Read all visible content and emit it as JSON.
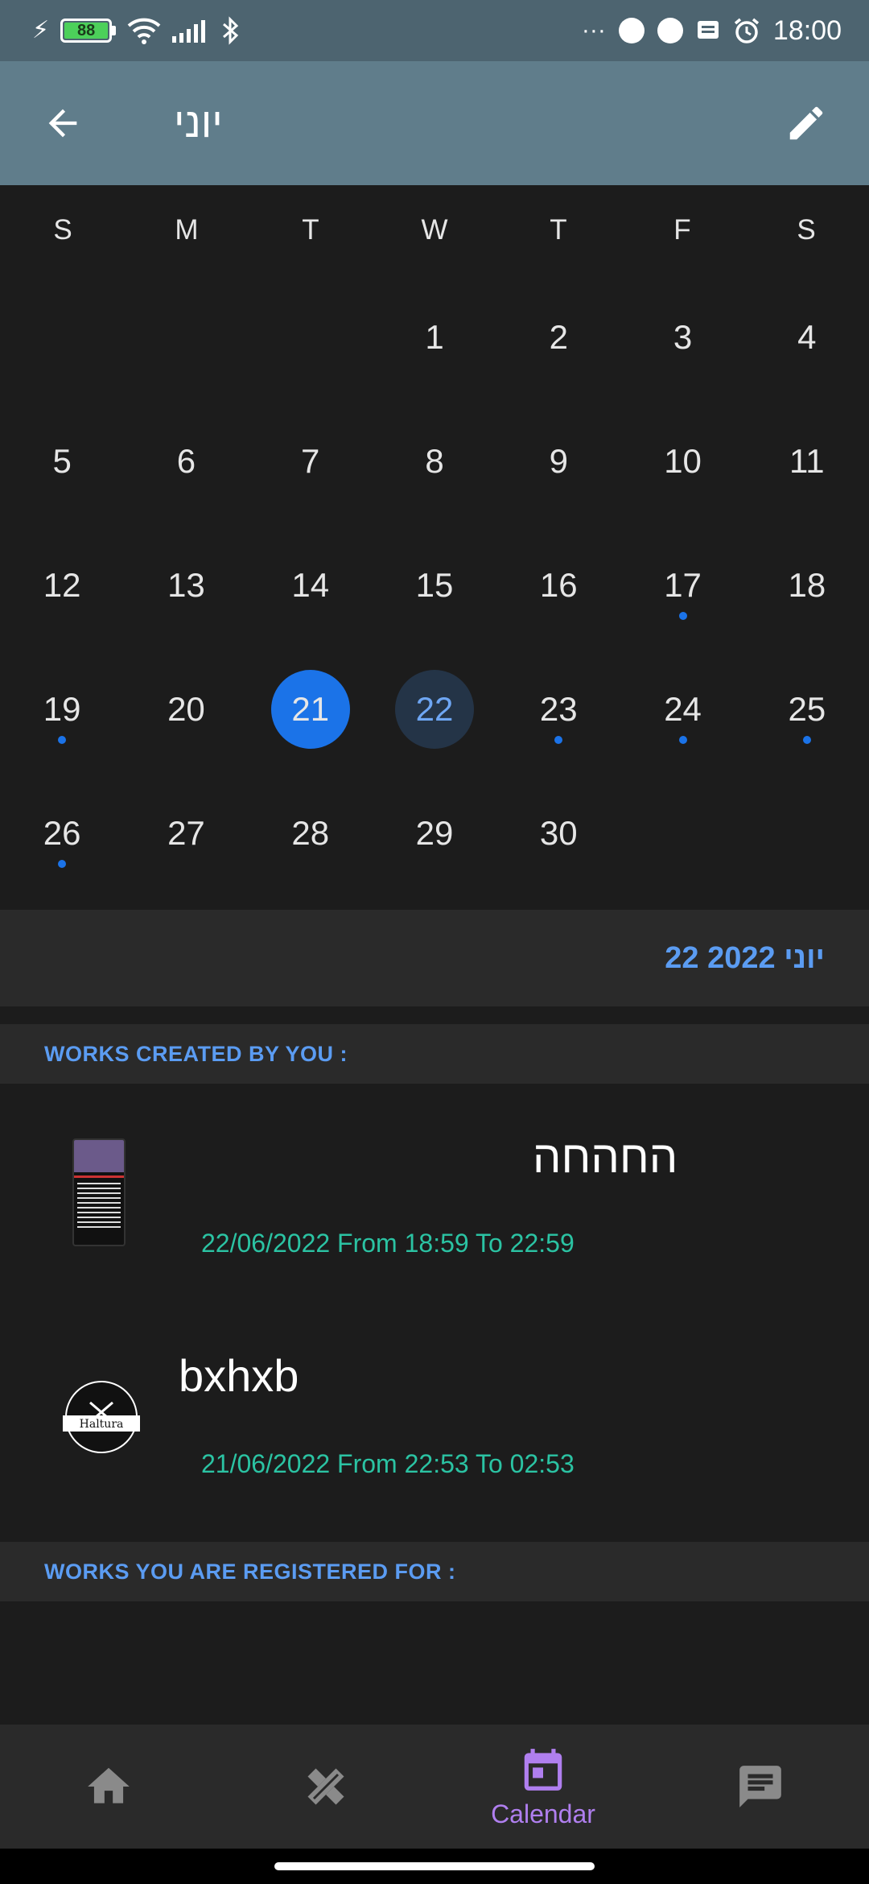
{
  "status_bar": {
    "battery": "88",
    "time": "18:00",
    "more": "···"
  },
  "app_bar": {
    "title": "יוני",
    "back_icon": "arrow-back-icon",
    "edit_icon": "pencil-icon"
  },
  "calendar": {
    "weekdays": [
      "S",
      "M",
      "T",
      "W",
      "T",
      "F",
      "S"
    ],
    "leading_blanks": 3,
    "days": [
      "1",
      "2",
      "3",
      "4",
      "5",
      "6",
      "7",
      "8",
      "9",
      "10",
      "11",
      "12",
      "13",
      "14",
      "15",
      "16",
      "17",
      "18",
      "19",
      "20",
      "21",
      "22",
      "23",
      "24",
      "25",
      "26",
      "27",
      "28",
      "29",
      "30"
    ],
    "selected_day": "21",
    "today_day": "22",
    "event_days": [
      "17",
      "19",
      "23",
      "24",
      "25",
      "26"
    ],
    "colors": {
      "selected": "#1b73e8",
      "today_bg": "#243447",
      "event_dot": "#1b73e8"
    }
  },
  "selected_date_label": "22 יוני 2022",
  "sections": {
    "created_by_you": "WORKS CREATED BY YOU :",
    "registered_for": "WORKS YOU ARE REGISTERED FOR :"
  },
  "works_created": [
    {
      "name": "החהחה",
      "time": "22/06/2022 From 18:59 To 22:59",
      "thumb": "phone-screenshot-thumbnail"
    },
    {
      "name": "bxhxb",
      "time": "21/06/2022 From 22:53 To 02:53",
      "thumb": "haltura-logo",
      "logo_text": "Haltura"
    }
  ],
  "bottom_nav": {
    "items": [
      {
        "icon": "home-icon",
        "label": ""
      },
      {
        "icon": "tools-icon",
        "label": ""
      },
      {
        "icon": "calendar-icon",
        "label": "Calendar"
      },
      {
        "icon": "chat-icon",
        "label": ""
      }
    ],
    "active_color": "#b07fef",
    "inactive_color": "#8a8a8a"
  }
}
